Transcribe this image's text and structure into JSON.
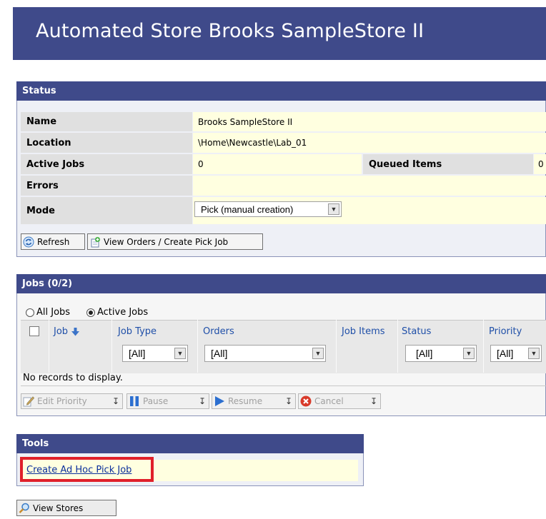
{
  "page": {
    "title": "Automated Store Brooks SampleStore II"
  },
  "status": {
    "header": "Status",
    "rows": {
      "name_label": "Name",
      "name_value": "Brooks SampleStore II",
      "location_label": "Location",
      "location_value": "\\Home\\Newcastle\\Lab_01",
      "active_jobs_label": "Active Jobs",
      "active_jobs_value": "0",
      "queued_items_label": "Queued Items",
      "queued_items_value": "0",
      "errors_label": "Errors",
      "errors_value": "",
      "mode_label": "Mode",
      "mode_value": "Pick (manual creation)"
    },
    "buttons": {
      "refresh": "Refresh",
      "view_orders": "View Orders / Create Pick Job"
    }
  },
  "jobs": {
    "header": "Jobs (0/2)",
    "filter": {
      "all_jobs": "All Jobs",
      "active_jobs": "Active Jobs",
      "selected": "Active Jobs"
    },
    "columns": {
      "job": "Job",
      "job_type": "Job Type",
      "orders": "Orders",
      "job_items": "Job Items",
      "status": "Status",
      "priority": "Priority"
    },
    "filters": {
      "job_type": "[All]",
      "orders": "[All]",
      "status": "[All]",
      "priority": "[All]"
    },
    "empty_message": "No records to display.",
    "actions": {
      "edit_priority": "Edit Priority",
      "pause": "Pause",
      "resume": "Resume",
      "cancel": "Cancel"
    }
  },
  "tools": {
    "header": "Tools",
    "link": "Create Ad Hoc Pick Job"
  },
  "footer": {
    "view_stores": "View Stores"
  },
  "colors": {
    "panel_header": "#3f4a8a",
    "value_bg": "#ffffe0",
    "label_bg": "#e0e0e0",
    "highlight": "#e0202a"
  }
}
